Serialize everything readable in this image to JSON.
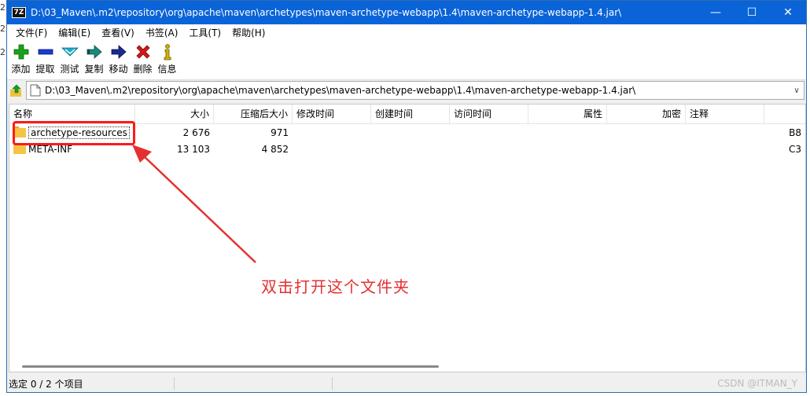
{
  "edge_text": [
    "2",
    "2",
    "2"
  ],
  "window": {
    "app_icon_text": "7Z",
    "title": "D:\\03_Maven\\.m2\\repository\\org\\apache\\maven\\archetypes\\maven-archetype-webapp\\1.4\\maven-archetype-webapp-1.4.jar\\",
    "controls": {
      "minimize": "—",
      "maximize": "☐",
      "close": "✕"
    }
  },
  "menu": [
    {
      "label": "文件(F)"
    },
    {
      "label": "编辑(E)"
    },
    {
      "label": "查看(V)"
    },
    {
      "label": "书签(A)"
    },
    {
      "label": "工具(T)"
    },
    {
      "label": "帮助(H)"
    }
  ],
  "toolbar": [
    {
      "label": "添加",
      "icon": "plus-icon",
      "color": "#1aa01a"
    },
    {
      "label": "提取",
      "icon": "minus-icon",
      "color": "#1a3ad0"
    },
    {
      "label": "测试",
      "icon": "check-icon",
      "color": "#20a8c8"
    },
    {
      "label": "复制",
      "icon": "copy-arrow-icon",
      "color": "#1a8a7a"
    },
    {
      "label": "移动",
      "icon": "move-arrow-icon",
      "color": "#1a2a90"
    },
    {
      "label": "删除",
      "icon": "delete-x-icon",
      "color": "#d01a1a"
    },
    {
      "label": "信息",
      "icon": "info-icon",
      "color": "#d0b000"
    }
  ],
  "address": {
    "path": "D:\\03_Maven\\.m2\\repository\\org\\apache\\maven\\archetypes\\maven-archetype-webapp\\1.4\\maven-archetype-webapp-1.4.jar\\"
  },
  "columns": [
    "名称",
    "大小",
    "压缩后大小",
    "修改时间",
    "创建时间",
    "访问时间",
    "属性",
    "加密",
    "注释"
  ],
  "rows": [
    {
      "name": "archetype-resources",
      "size": "2 676",
      "packed": "971",
      "modified": "",
      "created": "",
      "accessed": "",
      "attr": "",
      "enc": "",
      "comment": "",
      "extra": "B8"
    },
    {
      "name": "META-INF",
      "size": "13 103",
      "packed": "4 852",
      "modified": "",
      "created": "",
      "accessed": "",
      "attr": "",
      "enc": "",
      "comment": "",
      "extra": "C3"
    }
  ],
  "annotation": "双击打开这个文件夹",
  "annotation_color": "#e53030",
  "status": {
    "text": "选定 0 / 2 个项目"
  },
  "watermark": "CSDN @ITMAN_Y"
}
